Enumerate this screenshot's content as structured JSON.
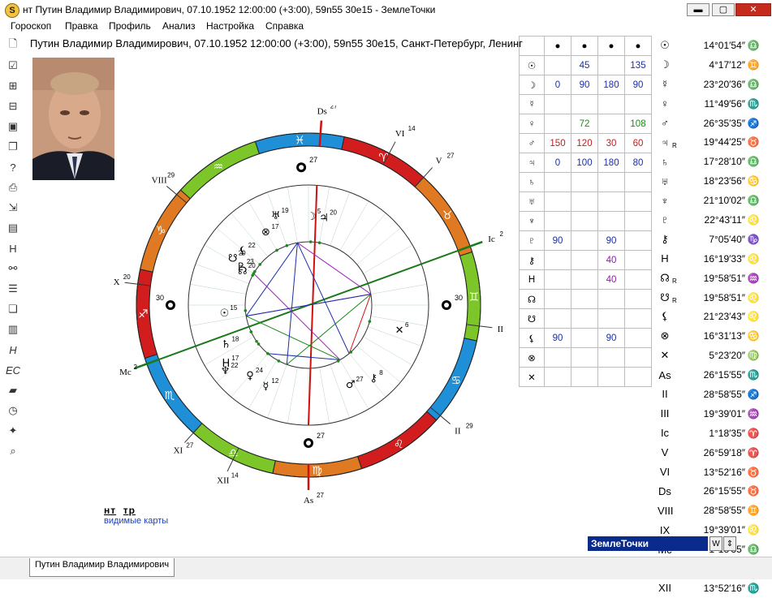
{
  "window": {
    "title": "нт Путин Владимир Владимирович, 07.10.1952 12:00:00 (+3:00), 59n55 30e15 - ЗемлеТочки",
    "minimize": "▬",
    "maximize": "▢",
    "close": "✕"
  },
  "menu": [
    "Гороскоп",
    "Правка",
    "Профиль",
    "Анализ",
    "Настройка",
    "Справка"
  ],
  "header": "Путин Владимир Владимирович, 07.10.1952 12:00:00 (+3:00), 59n55 30e15, Санкт-Петербург, Ленинг",
  "aspect_table": {
    "columns": [
      "●",
      "●",
      "●",
      "●"
    ],
    "rows": [
      {
        "label": "☉",
        "cells": [
          "",
          "45",
          "",
          "135"
        ]
      },
      {
        "label": "☽",
        "cells": [
          "0",
          "90",
          "180",
          "90"
        ]
      },
      {
        "label": "☿",
        "cells": [
          "",
          "",
          "",
          ""
        ]
      },
      {
        "label": "♀",
        "cells": [
          "",
          "72",
          "",
          "108"
        ]
      },
      {
        "label": "♂",
        "cells": [
          "150",
          "120",
          "30",
          "60"
        ]
      },
      {
        "label": "♃",
        "cells": [
          "0",
          "100",
          "180",
          "80"
        ]
      },
      {
        "label": "♄",
        "cells": [
          "",
          "",
          "",
          ""
        ]
      },
      {
        "label": "♅",
        "cells": [
          "",
          "",
          "",
          ""
        ]
      },
      {
        "label": "♆",
        "cells": [
          "",
          "",
          "",
          ""
        ]
      },
      {
        "label": "♇",
        "cells": [
          "90",
          "",
          "90",
          ""
        ]
      },
      {
        "label": "⚷",
        "cells": [
          "",
          "",
          "40",
          ""
        ]
      },
      {
        "label": "H",
        "cells": [
          "",
          "",
          "40",
          ""
        ]
      },
      {
        "label": "☊",
        "cells": [
          "",
          "",
          "",
          ""
        ]
      },
      {
        "label": "☋",
        "cells": [
          "",
          "",
          "",
          ""
        ]
      },
      {
        "label": "⚸",
        "cells": [
          "90",
          "",
          "90",
          ""
        ]
      },
      {
        "label": "⊗",
        "cells": [
          "",
          "",
          "",
          ""
        ]
      },
      {
        "label": "✕",
        "cells": [
          "",
          "",
          "",
          ""
        ]
      }
    ]
  },
  "planets": [
    {
      "sym": "☉",
      "r": "",
      "deg": "14°01′54″",
      "sign": "♎"
    },
    {
      "sym": "☽",
      "r": "",
      "deg": "4°17′12″",
      "sign": "♊"
    },
    {
      "sym": "☿",
      "r": "",
      "deg": "23°20′36″",
      "sign": "♎"
    },
    {
      "sym": "♀",
      "r": "",
      "deg": "11°49′56″",
      "sign": "♏"
    },
    {
      "sym": "♂",
      "r": "",
      "deg": "26°35′35″",
      "sign": "♐"
    },
    {
      "sym": "♃",
      "r": "R",
      "deg": "19°44′25″",
      "sign": "♉"
    },
    {
      "sym": "♄",
      "r": "",
      "deg": "17°28′10″",
      "sign": "♎"
    },
    {
      "sym": "♅",
      "r": "",
      "deg": "18°23′56″",
      "sign": "♋"
    },
    {
      "sym": "♆",
      "r": "",
      "deg": "21°10′02″",
      "sign": "♎"
    },
    {
      "sym": "♇",
      "r": "",
      "deg": "22°43′11″",
      "sign": "♌"
    },
    {
      "sym": "⚷",
      "r": "",
      "deg": "7°05′40″",
      "sign": "♑"
    },
    {
      "sym": "H",
      "r": "",
      "deg": "16°19′33″",
      "sign": "♌"
    },
    {
      "sym": "☊",
      "r": "R",
      "deg": "19°58′51″",
      "sign": "♒"
    },
    {
      "sym": "☋",
      "r": "R",
      "deg": "19°58′51″",
      "sign": "♌"
    },
    {
      "sym": "⚸",
      "r": "",
      "deg": "21°23′43″",
      "sign": "♌"
    },
    {
      "sym": "⊗",
      "r": "",
      "deg": "16°31′13″",
      "sign": "♋"
    },
    {
      "sym": "✕",
      "r": "",
      "deg": "5°23′20″",
      "sign": "♍"
    },
    {
      "sym": "As",
      "r": "",
      "deg": "26°15′55″",
      "sign": "♏"
    },
    {
      "sym": "II",
      "r": "",
      "deg": "28°58′55″",
      "sign": "♐"
    },
    {
      "sym": "III",
      "r": "",
      "deg": "19°39′01″",
      "sign": "♒"
    },
    {
      "sym": "Ic",
      "r": "",
      "deg": "1°18′35″",
      "sign": "♈"
    },
    {
      "sym": "V",
      "r": "",
      "deg": "26°59′18″",
      "sign": "♈"
    },
    {
      "sym": "VI",
      "r": "",
      "deg": "13°52′16″",
      "sign": "♉"
    },
    {
      "sym": "Ds",
      "r": "",
      "deg": "26°15′55″",
      "sign": "♉"
    },
    {
      "sym": "VIII",
      "r": "",
      "deg": "28°58′55″",
      "sign": "♊"
    },
    {
      "sym": "IX",
      "r": "",
      "deg": "19°39′01″",
      "sign": "♌"
    },
    {
      "sym": "Mc",
      "r": "",
      "deg": "1°18′35″",
      "sign": "♎"
    },
    {
      "sym": "XI",
      "r": "",
      "deg": "26°59′18″",
      "sign": "♎"
    },
    {
      "sym": "XII",
      "r": "",
      "deg": "13°52′16″",
      "sign": "♏"
    }
  ],
  "wheel": {
    "signs": [
      {
        "glyph": "♈",
        "color": "#d11d1d"
      },
      {
        "glyph": "♉",
        "color": "#e07a22"
      },
      {
        "glyph": "♊",
        "color": "#7cc62a"
      },
      {
        "glyph": "♋",
        "color": "#1f8fd8"
      },
      {
        "glyph": "♌",
        "color": "#d11d1d"
      },
      {
        "glyph": "♍",
        "color": "#e07a22"
      },
      {
        "glyph": "♎",
        "color": "#7cc62a"
      },
      {
        "glyph": "♏",
        "color": "#1f8fd8"
      },
      {
        "glyph": "♐",
        "color": "#d11d1d"
      },
      {
        "glyph": "♑",
        "color": "#e07a22"
      },
      {
        "glyph": "♒",
        "color": "#7cc62a"
      },
      {
        "glyph": "♓",
        "color": "#1f8fd8"
      }
    ],
    "cusps": [
      {
        "label": "Ds",
        "sup": "27"
      },
      {
        "label": "VI",
        "sup": "14"
      },
      {
        "label": "V",
        "sup": "27"
      },
      {
        "label": "Ic",
        "sup": "2"
      },
      {
        "label": "III",
        "sup": "20"
      },
      {
        "label": "II",
        "sup": "29"
      },
      {
        "label": "As",
        "sup": "27"
      },
      {
        "label": "XII",
        "sup": "14"
      },
      {
        "label": "XI",
        "sup": "27"
      },
      {
        "label": "Mc",
        "sup": "2"
      },
      {
        "label": "IX",
        "sup": "20"
      },
      {
        "label": "VIII",
        "sup": "29"
      }
    ],
    "points": [
      {
        "label": "27"
      },
      {
        "label": "30"
      },
      {
        "label": "27"
      },
      {
        "label": "30"
      }
    ],
    "planet_labels": [
      {
        "glyph": "☽",
        "deg": "5"
      },
      {
        "glyph": "♃",
        "deg": "20"
      },
      {
        "glyph": "♅",
        "deg": "19"
      },
      {
        "glyph": "⊗",
        "deg": "17"
      },
      {
        "glyph": "⚸",
        "deg": "22"
      },
      {
        "glyph": "☋",
        "deg": "20"
      },
      {
        "glyph": "♇",
        "deg": "23"
      },
      {
        "glyph": "☊",
        "deg": "20"
      },
      {
        "glyph": "✕",
        "deg": "6"
      },
      {
        "glyph": "☉",
        "deg": "15"
      },
      {
        "glyph": "♄",
        "deg": "18"
      },
      {
        "glyph": "H",
        "deg": "17"
      },
      {
        "glyph": "♀",
        "deg": "24"
      },
      {
        "glyph": "☿",
        "deg": "12"
      },
      {
        "glyph": "♆",
        "deg": "22"
      },
      {
        "glyph": "♂",
        "deg": "27"
      },
      {
        "glyph": "⚷",
        "deg": "8"
      }
    ]
  },
  "legend": {
    "tab1": "нт",
    "tab2": "тр",
    "sub": "видимые карты"
  },
  "combo": {
    "value": "ЗемлеТочки",
    "btn1": "W",
    "btn2": "⇕"
  },
  "status_tab": "Путин Владимир Владимирович"
}
